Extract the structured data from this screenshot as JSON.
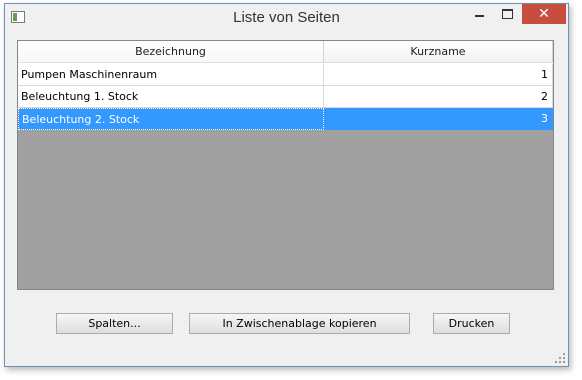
{
  "window": {
    "title": "Liste von Seiten",
    "close_glyph": "✕"
  },
  "table": {
    "columns": [
      "Bezeichnung",
      "Kurzname"
    ],
    "rows": [
      {
        "name": "Pumpen Maschinenraum",
        "short": "1"
      },
      {
        "name": "Beleuchtung 1. Stock",
        "short": "2"
      },
      {
        "name": "Beleuchtung 2. Stock",
        "short": "3"
      }
    ],
    "selected_row": 2
  },
  "buttons": {
    "columns": "Spalten...",
    "copy": "In Zwischenablage kopieren",
    "print": "Drucken"
  },
  "colors": {
    "selection": "#3399ff",
    "grid_background": "#a0a0a0",
    "close_button": "#c74e3f"
  }
}
